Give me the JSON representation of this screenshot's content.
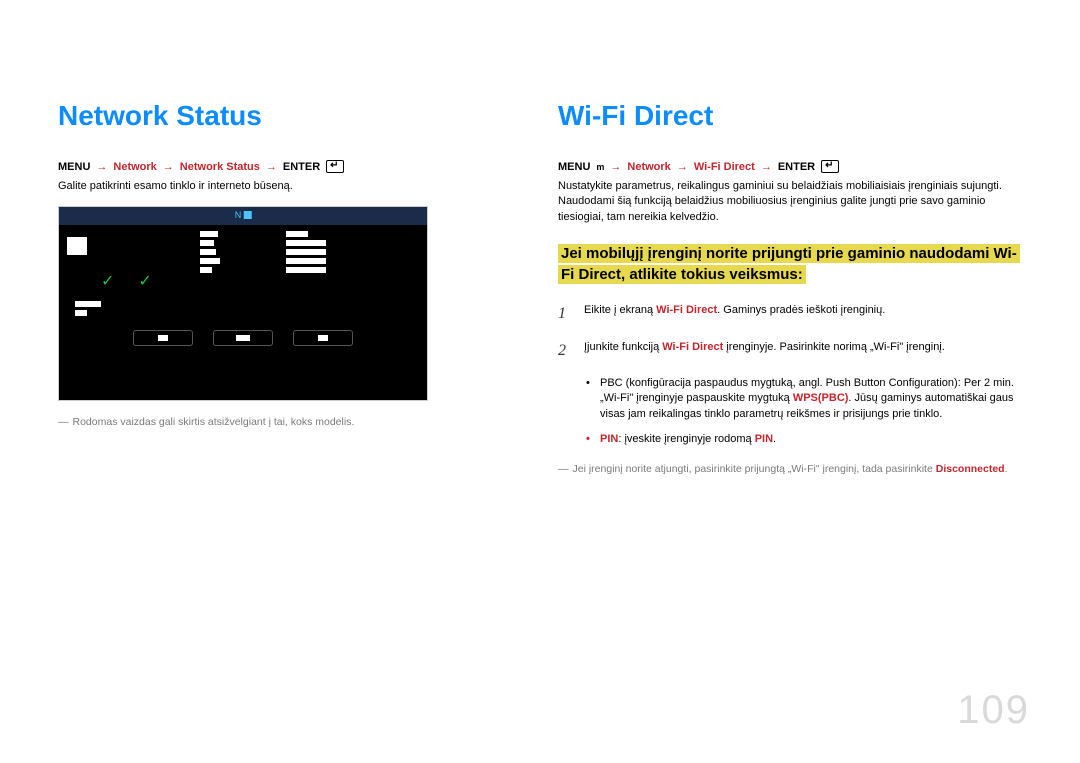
{
  "pageNumber": "109",
  "left": {
    "heading": "Network Status",
    "menu": {
      "label": "MENU",
      "l1": "Network",
      "l2": "Network Status",
      "l3": "ENTER"
    },
    "description": "Galite patikrinti esamo tinklo ir interneto būseną.",
    "screenshot": {
      "topLabel": "N"
    },
    "footnote": "Rodomas vaizdas gali skirtis atsižvelgiant į tai, koks modelis."
  },
  "right": {
    "heading": "Wi-Fi Direct",
    "menu": {
      "label": "MENU",
      "mIcon": "m",
      "l1": "Network",
      "l2": "Wi-Fi Direct",
      "l3": "ENTER"
    },
    "description": "Nustatykite parametrus, reikalingus gaminiui su belaidžiais mobiliaisiais įrenginiais sujungti. Naudodami šią funkciją belaidžius mobiliuosius įrenginius galite jungti prie savo gaminio tiesiogiai, tam nereikia kelvedžio.",
    "highlight": "Jei mobilųjį įrenginį norite prijungti prie gaminio naudodami Wi-Fi Direct, atlikite tokius veiksmus:",
    "steps": [
      {
        "num": "1",
        "pre": "Eikite į ekraną ",
        "strong": "Wi-Fi Direct",
        "post": ". Gaminys pradės ieškoti įrenginių."
      },
      {
        "num": "2",
        "pre": "Įjunkite funkciją ",
        "strong": "Wi-Fi Direct",
        "post": " įrenginyje. Pasirinkite norimą „Wi-Fi\" įrenginį."
      }
    ],
    "bullets": [
      {
        "highlight": false,
        "pre": "PBC (konfigūracija paspaudus mygtuką, angl. Push Button Configuration): Per 2 min. „Wi-Fi\" įrenginyje paspauskite mygtuką ",
        "strong": "WPS(PBC)",
        "post": ". Jūsų gaminys automatiškai gaus visas jam reikalingas tinklo parametrų reikšmes ir prisijungs prie tinklo."
      },
      {
        "highlight": true,
        "strong1": "PIN",
        "mid": ": įveskite įrenginyje rodomą ",
        "strong2": "PIN",
        "post": "."
      }
    ],
    "footnote": {
      "pre": "Jei įrenginį norite atjungti, pasirinkite prijungtą „Wi-Fi\" įrenginį, tada pasirinkite ",
      "strong": "Disconnected",
      "post": "."
    }
  },
  "arrows": "→",
  "dash": "―"
}
